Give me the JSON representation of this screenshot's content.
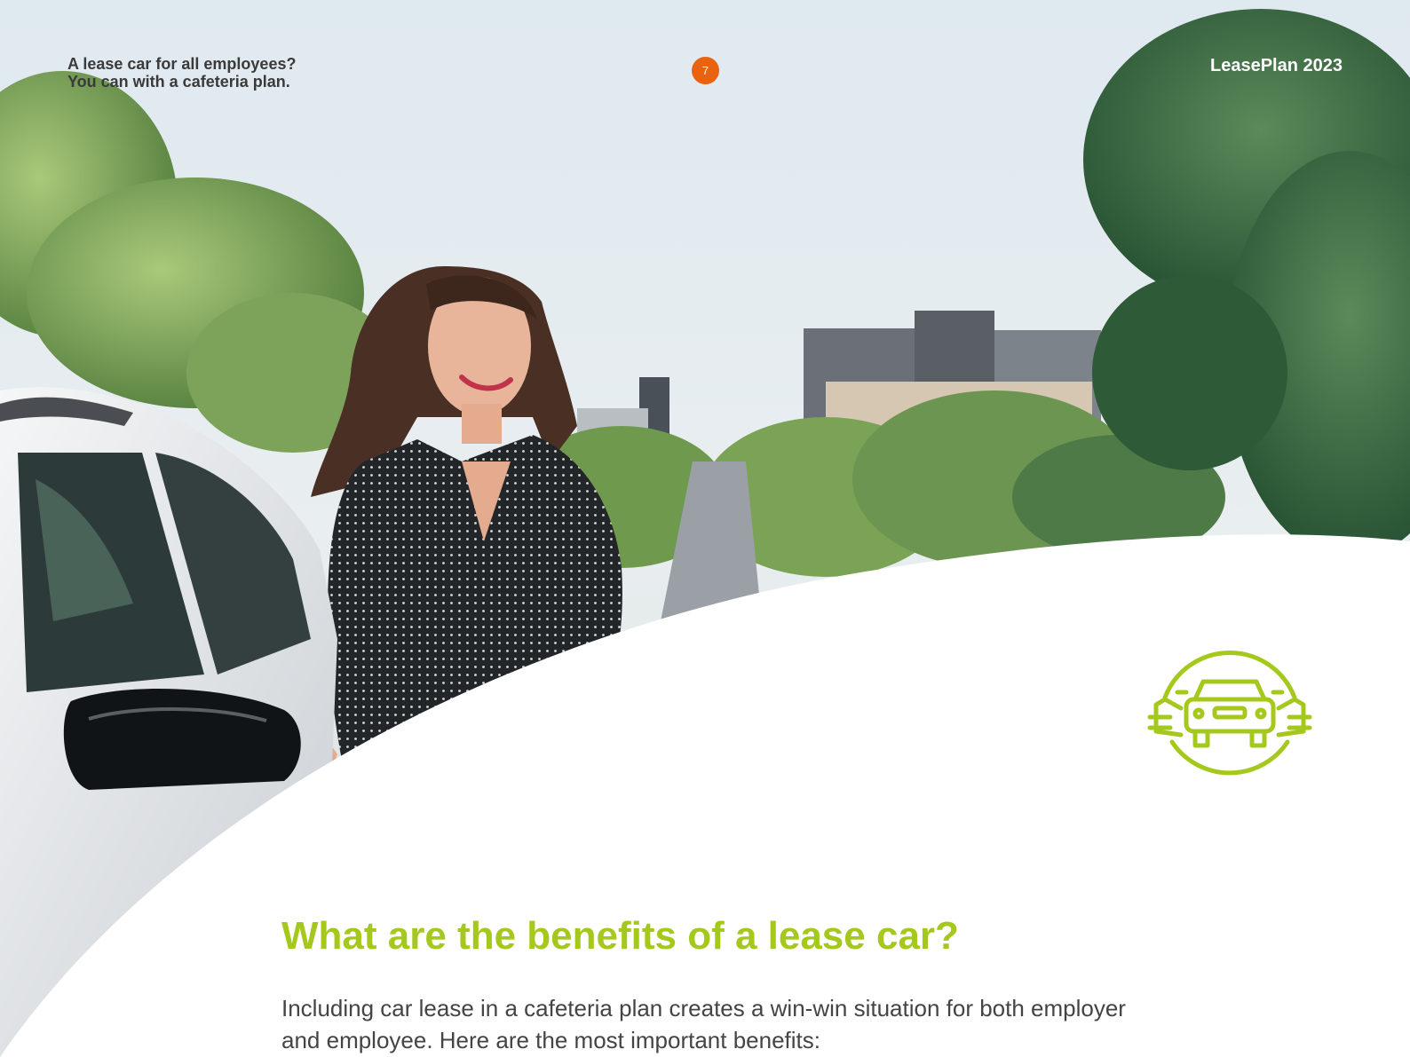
{
  "header": {
    "title_line1": "A lease car for all employees?",
    "title_line2": "You can with a cafeteria plan.",
    "page_number": "7",
    "brand": "LeasePlan 2023"
  },
  "main": {
    "heading": "What are the benefits of a lease car?",
    "intro_line1": "Including car lease in a cafeteria plan creates a win-win situation for both employer",
    "intro_line2": "and employee. Here are the most important benefits:"
  },
  "colors": {
    "accent_green": "#a5c81c",
    "page_badge_orange": "#e8620f"
  },
  "icons": {
    "illustration": "woman-beside-car-photo",
    "feature_icon": "cars-in-circle-icon"
  }
}
